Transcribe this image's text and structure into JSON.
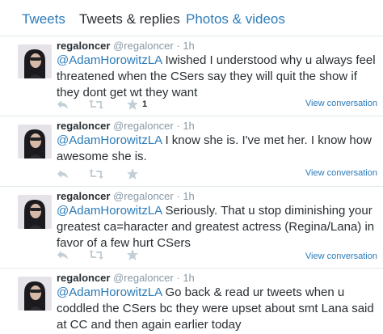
{
  "tabs": [
    {
      "label": "Tweets"
    },
    {
      "label": "Tweets & replies"
    },
    {
      "label": "Photos & videos"
    }
  ],
  "tweets": [
    {
      "name": "regaloncer",
      "handle": "@regaloncer",
      "dot": "·",
      "time": "1h",
      "mention": "@AdamHorowitzLA",
      "text": " Iwished I understood why u always feel threatened when the CSers say they will quit the show if they dont get wt they want",
      "fav_count": "1",
      "view_conversation": "View conversation"
    },
    {
      "name": "regaloncer",
      "handle": "@regaloncer",
      "dot": "·",
      "time": "1h",
      "mention": "@AdamHorowitzLA",
      "text": " I know she is. I've met her. I know how awesome she is.",
      "view_conversation": "View conversation"
    },
    {
      "name": "regaloncer",
      "handle": "@regaloncer",
      "dot": "·",
      "time": "1h",
      "mention": "@AdamHorowitzLA",
      "text": " Seriously. That u stop diminishing your greatest ca=haracter and greatest actress (Regina/Lana) in favor of a few hurt CSers",
      "view_conversation": "View conversation"
    },
    {
      "name": "regaloncer",
      "handle": "@regaloncer",
      "dot": "·",
      "time": "1h",
      "mention": "@AdamHorowitzLA",
      "text": " Go back & read ur tweets when u coddled the CSers bc they were upset about smt Lana said at CC and then again earlier today"
    }
  ],
  "colors": {
    "link": "#2b7bb9",
    "text": "#292f33",
    "muted": "#8899a6",
    "icon": "#c3cfd6",
    "divider": "#e1e8ed"
  }
}
